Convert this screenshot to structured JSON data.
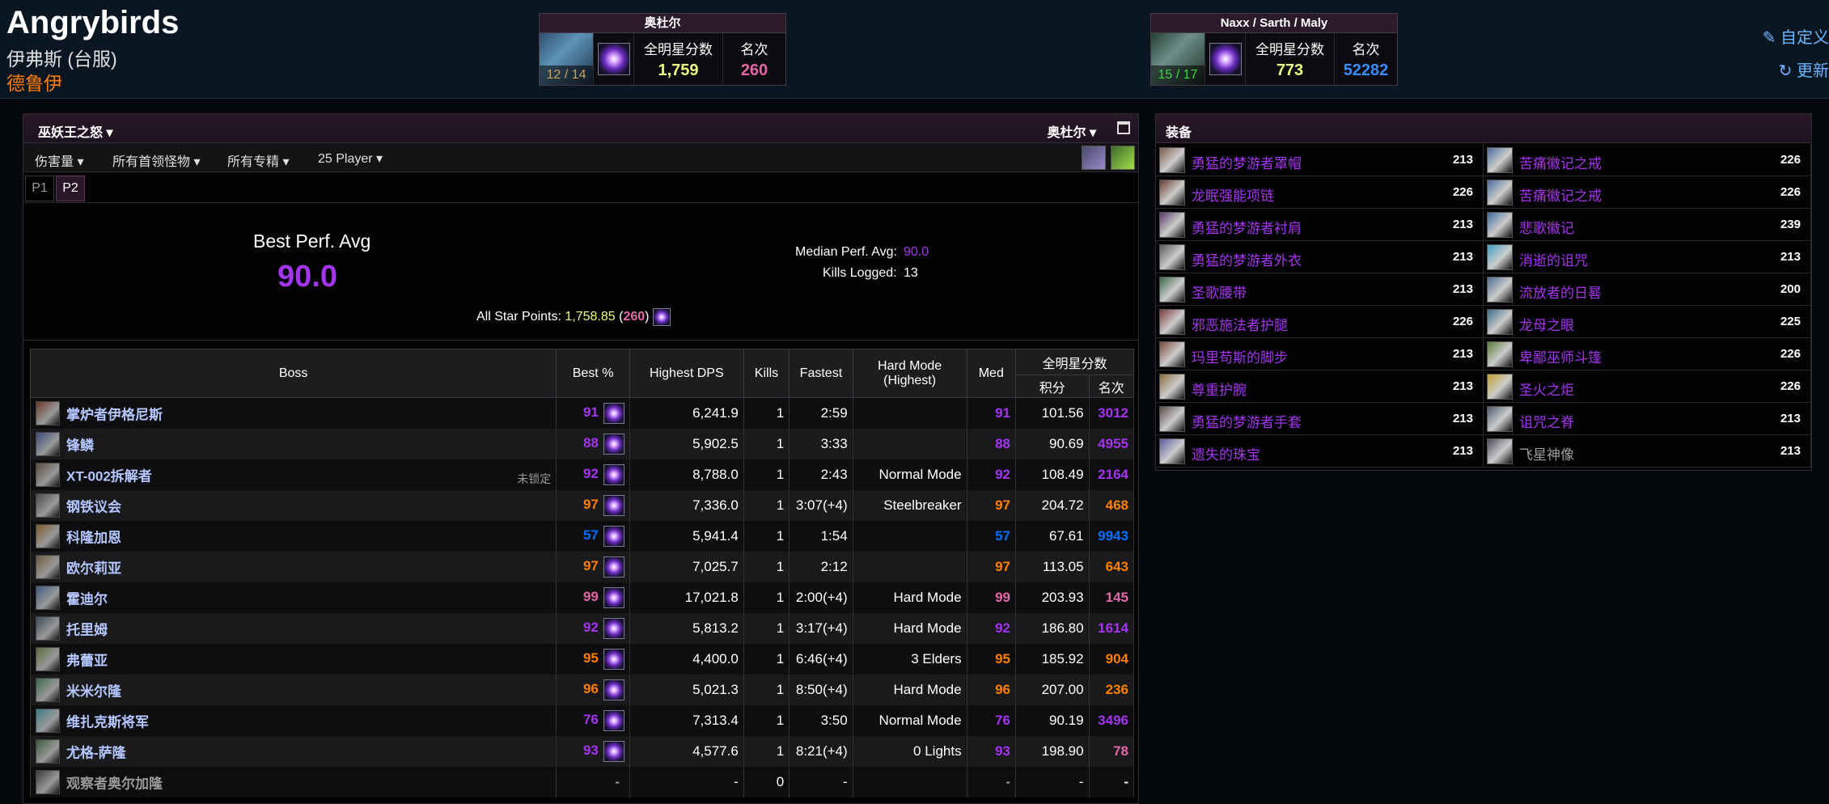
{
  "character": {
    "name": "Angrybirds",
    "server": "伊弗斯 (台服)",
    "class": "德鲁伊"
  },
  "zones": [
    {
      "title": "奥杜尔",
      "count": "12 / 14",
      "star_label": "全明星分数",
      "star_value": "1,759",
      "rank_label": "名次",
      "rank_value": "260",
      "star_color": "#e6ff80",
      "rank_color": "#e268a8"
    },
    {
      "title": "Naxx / Sarth / Maly",
      "count": "15 / 17",
      "star_label": "全明星分数",
      "star_value": "773",
      "rank_label": "名次",
      "rank_value": "52282",
      "star_color": "#e6ff80",
      "rank_color": "#0070ff"
    }
  ],
  "actions": {
    "customize": "自定义",
    "refresh": "更新"
  },
  "rankings": {
    "title": "巫妖王之怒",
    "zone_select": "奥杜尔",
    "filters": [
      "伤害量",
      "所有首领怪物",
      "所有专精",
      "25 Player"
    ],
    "phases": [
      "P1",
      "P2"
    ],
    "best_perf_label": "Best Perf. Avg",
    "best_perf_value": "90.0",
    "median_label": "Median Perf. Avg:",
    "median_value": "90.0",
    "kills_label": "Kills Logged:",
    "kills_value": "13",
    "allstar_label": "All Star Points:",
    "allstar_value": "1,758.85",
    "allstar_rank": "260"
  },
  "table": {
    "headers": {
      "boss": "Boss",
      "best": "Best %",
      "dps": "Highest DPS",
      "kills": "Kills",
      "fastest": "Fastest",
      "hardmode": "Hard Mode",
      "hardmode2": "(Highest)",
      "med": "Med",
      "allstar": "全明星分数",
      "points": "积分",
      "rank": "名次"
    },
    "rows": [
      {
        "boss": "掌炉者伊格尼斯",
        "best": "91",
        "dps": "6,241.9",
        "kills": "1",
        "fastest": "2:59",
        "hard": "",
        "med": "91",
        "pts": "101.56",
        "rank": "3012",
        "pc": "#a335ee",
        "rc": "#a335ee",
        "note": ""
      },
      {
        "boss": "锋鳞",
        "best": "88",
        "dps": "5,902.5",
        "kills": "1",
        "fastest": "3:33",
        "hard": "",
        "med": "88",
        "pts": "90.69",
        "rank": "4955",
        "pc": "#a335ee",
        "rc": "#a335ee",
        "note": ""
      },
      {
        "boss": "XT-002拆解者",
        "best": "92",
        "dps": "8,788.0",
        "kills": "1",
        "fastest": "2:43",
        "hard": "Normal Mode",
        "med": "92",
        "pts": "108.49",
        "rank": "2164",
        "pc": "#a335ee",
        "rc": "#a335ee",
        "note": "未锁定"
      },
      {
        "boss": "钢铁议会",
        "best": "97",
        "dps": "7,336.0",
        "kills": "1",
        "fastest": "3:07(+4)",
        "hard": "Steelbreaker",
        "med": "97",
        "pts": "204.72",
        "rank": "468",
        "pc": "#ff8000",
        "rc": "#ff8000",
        "note": ""
      },
      {
        "boss": "科隆加恩",
        "best": "57",
        "dps": "5,941.4",
        "kills": "1",
        "fastest": "1:54",
        "hard": "",
        "med": "57",
        "pts": "67.61",
        "rank": "9943",
        "pc": "#0070ff",
        "rc": "#0070ff",
        "note": ""
      },
      {
        "boss": "欧尔莉亚",
        "best": "97",
        "dps": "7,025.7",
        "kills": "1",
        "fastest": "2:12",
        "hard": "",
        "med": "97",
        "pts": "113.05",
        "rank": "643",
        "pc": "#ff8000",
        "rc": "#ff8000",
        "note": ""
      },
      {
        "boss": "霍迪尔",
        "best": "99",
        "dps": "17,021.8",
        "kills": "1",
        "fastest": "2:00(+4)",
        "hard": "Hard Mode",
        "med": "99",
        "pts": "203.93",
        "rank": "145",
        "pc": "#e268a8",
        "rc": "#e268a8",
        "note": ""
      },
      {
        "boss": "托里姆",
        "best": "92",
        "dps": "5,813.2",
        "kills": "1",
        "fastest": "3:17(+4)",
        "hard": "Hard Mode",
        "med": "92",
        "pts": "186.80",
        "rank": "1614",
        "pc": "#a335ee",
        "rc": "#a335ee",
        "note": ""
      },
      {
        "boss": "弗蕾亚",
        "best": "95",
        "dps": "4,400.0",
        "kills": "1",
        "fastest": "6:46(+4)",
        "hard": "3 Elders",
        "med": "95",
        "pts": "185.92",
        "rank": "904",
        "pc": "#ff8000",
        "rc": "#ff8000",
        "note": ""
      },
      {
        "boss": "米米尔隆",
        "best": "96",
        "dps": "5,021.3",
        "kills": "1",
        "fastest": "8:50(+4)",
        "hard": "Hard Mode",
        "med": "96",
        "pts": "207.00",
        "rank": "236",
        "pc": "#ff8000",
        "rc": "#ff8000",
        "note": ""
      },
      {
        "boss": "维扎克斯将军",
        "best": "76",
        "dps": "7,313.4",
        "kills": "1",
        "fastest": "3:50",
        "hard": "Normal Mode",
        "med": "76",
        "pts": "90.19",
        "rank": "3496",
        "pc": "#a335ee",
        "rc": "#a335ee",
        "note": ""
      },
      {
        "boss": "尤格-萨隆",
        "best": "93",
        "dps": "4,577.6",
        "kills": "1",
        "fastest": "8:21(+4)",
        "hard": "0 Lights",
        "med": "93",
        "pts": "198.90",
        "rank": "78",
        "pc": "#a335ee",
        "rc": "#e268a8",
        "note": ""
      },
      {
        "boss": "观察者奥尔加隆",
        "best": "-",
        "dps": "-",
        "kills": "0",
        "fastest": "-",
        "hard": "",
        "med": "-",
        "pts": "-",
        "rank": "-",
        "pc": "#9a9a9a",
        "rc": "#ffffff",
        "note": "",
        "grey": true
      }
    ]
  },
  "gear": {
    "title": "装备",
    "items": [
      {
        "name": "勇猛的梦游者罩帽",
        "ilvl": "213",
        "color": "#a335ee"
      },
      {
        "name": "苦痛徽记之戒",
        "ilvl": "226",
        "color": "#a335ee"
      },
      {
        "name": "龙眠强能项链",
        "ilvl": "226",
        "color": "#a335ee"
      },
      {
        "name": "苦痛徽记之戒",
        "ilvl": "226",
        "color": "#a335ee"
      },
      {
        "name": "勇猛的梦游者衬肩",
        "ilvl": "213",
        "color": "#a335ee"
      },
      {
        "name": "悲歌徽记",
        "ilvl": "239",
        "color": "#a335ee"
      },
      {
        "name": "勇猛的梦游者外衣",
        "ilvl": "213",
        "color": "#a335ee"
      },
      {
        "name": "消逝的诅咒",
        "ilvl": "213",
        "color": "#a335ee"
      },
      {
        "name": "圣歌腰带",
        "ilvl": "213",
        "color": "#a335ee"
      },
      {
        "name": "流放者的日晷",
        "ilvl": "200",
        "color": "#a335ee"
      },
      {
        "name": "邪恶施法者护腿",
        "ilvl": "226",
        "color": "#a335ee"
      },
      {
        "name": "龙母之眼",
        "ilvl": "225",
        "color": "#a335ee"
      },
      {
        "name": "玛里苟斯的脚步",
        "ilvl": "213",
        "color": "#a335ee"
      },
      {
        "name": "卑鄙巫师斗篷",
        "ilvl": "226",
        "color": "#a335ee"
      },
      {
        "name": "尊重护腕",
        "ilvl": "213",
        "color": "#a335ee"
      },
      {
        "name": "圣火之炬",
        "ilvl": "226",
        "color": "#a335ee"
      },
      {
        "name": "勇猛的梦游者手套",
        "ilvl": "213",
        "color": "#a335ee"
      },
      {
        "name": "诅咒之脊",
        "ilvl": "213",
        "color": "#a335ee"
      },
      {
        "name": "遗失的珠宝",
        "ilvl": "213",
        "color": "#a335ee"
      },
      {
        "name": "飞星神像",
        "ilvl": "213",
        "color": "#9d9d9d"
      }
    ]
  }
}
